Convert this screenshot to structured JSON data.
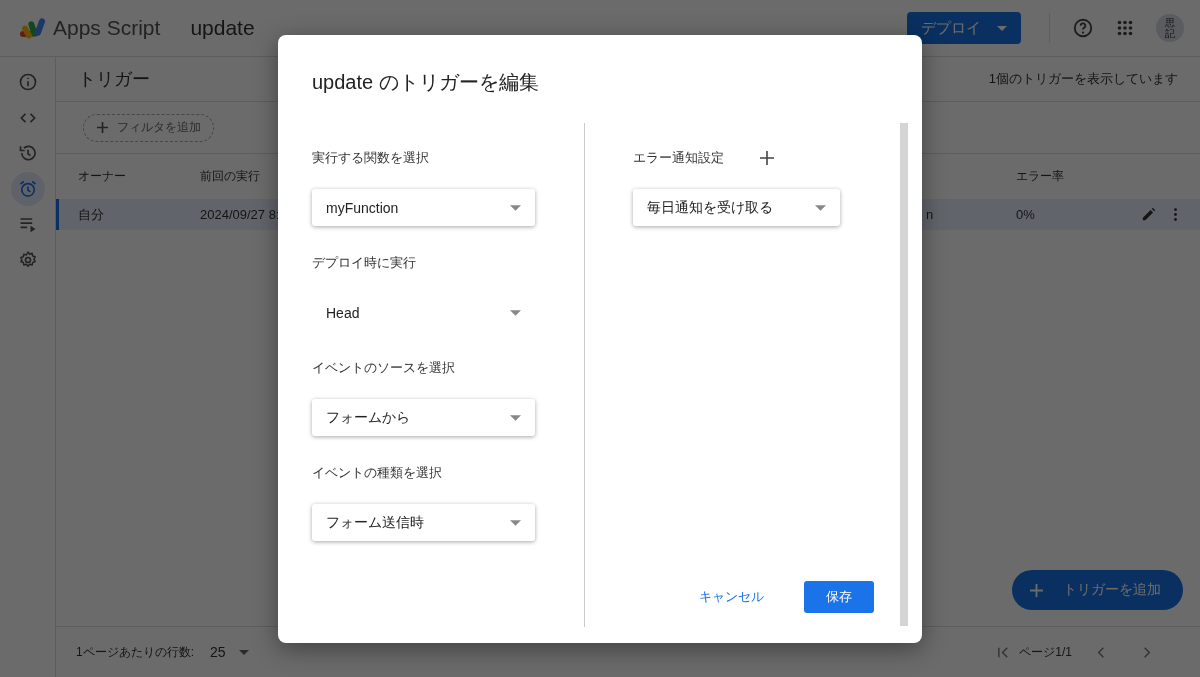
{
  "header": {
    "logo_text": "Apps Script",
    "project": "update",
    "deploy_button": "デプロイ",
    "avatar": "思記"
  },
  "sidebar": {
    "items": [
      {
        "kind": "info",
        "selected": false
      },
      {
        "kind": "code",
        "selected": false
      },
      {
        "kind": "history",
        "selected": false
      },
      {
        "kind": "alarm",
        "selected": true
      },
      {
        "kind": "executions",
        "selected": false
      },
      {
        "kind": "settings",
        "selected": false
      }
    ]
  },
  "page": {
    "title": "トリガー",
    "count": "1個のトリガーを表示しています",
    "filter_chip": "フィルタを追加"
  },
  "table": {
    "columns": [
      "オーナー",
      "前回の実行",
      "エラー率"
    ],
    "rows": [
      {
        "owner": "自分",
        "last_run": "2024/09/27 8:",
        "column_3": "n",
        "error_rate": "0%",
        "selected": true
      }
    ]
  },
  "fab": "トリガーを追加",
  "footer": {
    "rows_label": "1ページあたりの行数:",
    "rows_value": "25",
    "page": "ページ1/1"
  },
  "dialog": {
    "title": "update のトリガーを編集",
    "fields": [
      {
        "label": "実行する関数を選択",
        "value": "myFunction",
        "kind": "raised"
      },
      {
        "label": "デプロイ時に実行",
        "value": "Head",
        "kind": "flat"
      },
      {
        "label": "イベントのソースを選択",
        "value": "フォームから",
        "kind": "raised"
      },
      {
        "label": "イベントの種類を選択",
        "value": "フォーム送信時",
        "kind": "raised"
      }
    ],
    "error_label": "エラー通知設定",
    "error_value": "毎日通知を受け取る",
    "cancel": "キャンセル",
    "save": "保存"
  }
}
